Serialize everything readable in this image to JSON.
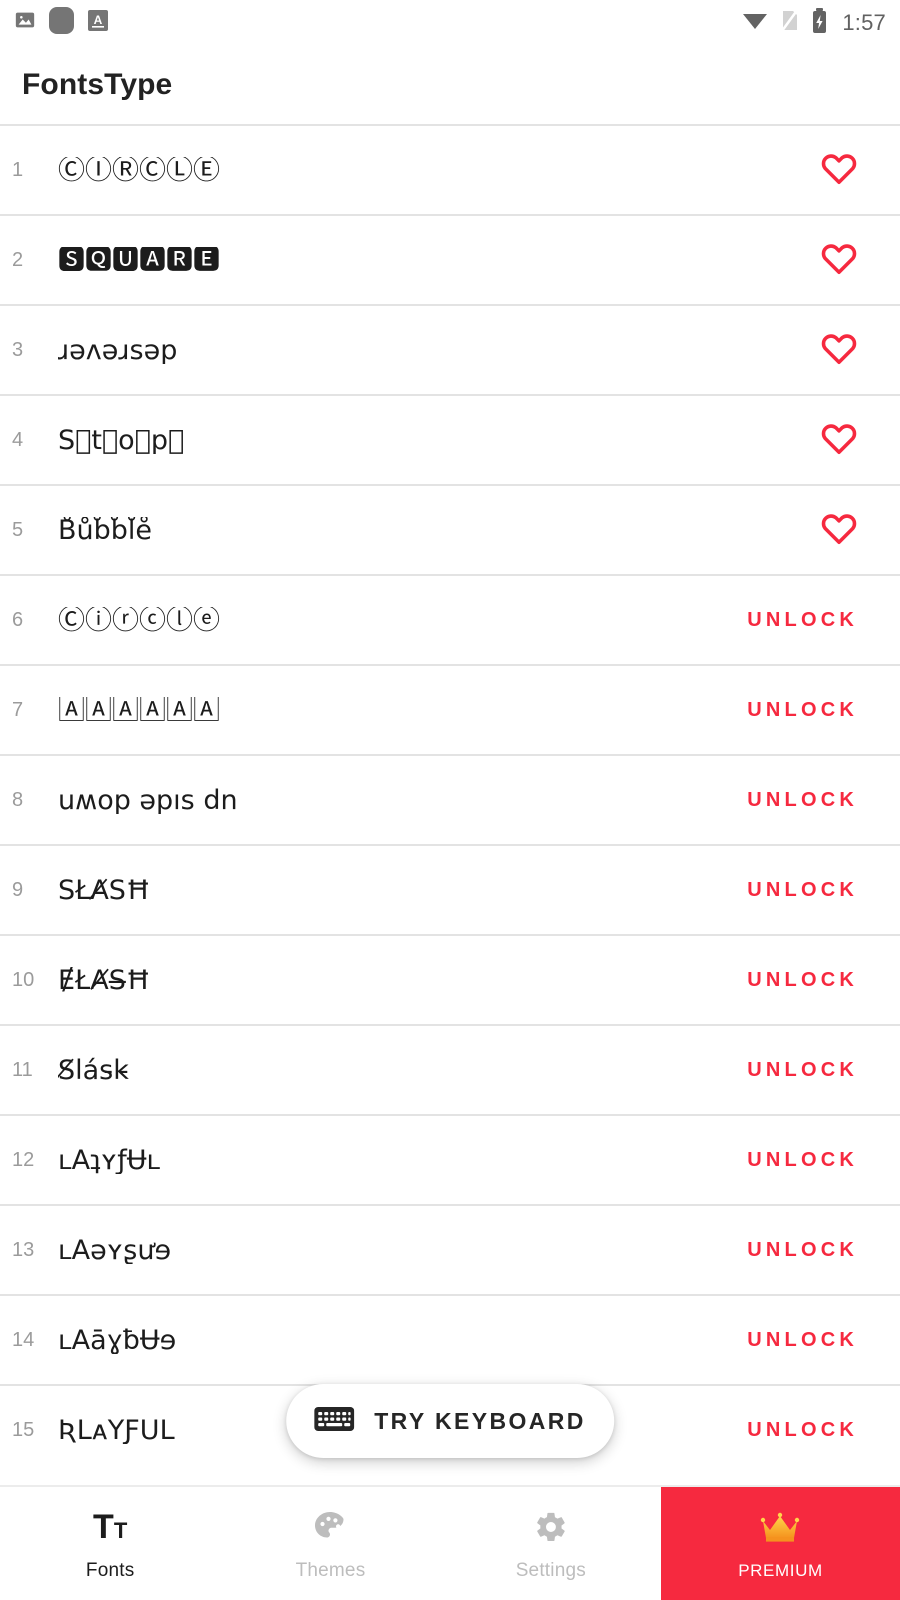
{
  "statusbar": {
    "time": "1:57",
    "left_icons": [
      "image-notification-icon",
      "rounded-square-notification-icon",
      "translate-notification-icon"
    ],
    "right_icons": [
      "wifi-icon",
      "no-sim-icon",
      "battery-charging-icon"
    ]
  },
  "header": {
    "title": "FontsType"
  },
  "list": {
    "rows": [
      {
        "index": "1",
        "sample": "ⒸⒾⓇⒸⓁⒺ",
        "action": "favorite",
        "unlock_label": ""
      },
      {
        "index": "2",
        "sample": "🆂🆀🆄🅰🆁🅴",
        "action": "favorite",
        "unlock_label": ""
      },
      {
        "index": "3",
        "sample": "ɹǝʌǝɹsǝp",
        "action": "favorite",
        "unlock_label": ""
      },
      {
        "index": "4",
        "sample": "S⃠t⃠o⃠p⃠",
        "action": "favorite",
        "unlock_label": ""
      },
      {
        "index": "5",
        "sample": "B̊ůb̊b̊l̊e̊",
        "action": "favorite",
        "unlock_label": ""
      },
      {
        "index": "6",
        "sample": "Ⓒⓘⓡⓒⓛⓔ",
        "action": "unlock",
        "unlock_label": "UNLOCK"
      },
      {
        "index": "7",
        "sample": "🄰🄰🄰🄰🄰🄰",
        "action": "unlock",
        "unlock_label": "UNLOCK"
      },
      {
        "index": "8",
        "sample": "uʍop ǝpıs dn",
        "action": "unlock",
        "unlock_label": "UNLOCK"
      },
      {
        "index": "9",
        "sample": "SŁA̸SĦ",
        "action": "unlock",
        "unlock_label": "UNLOCK"
      },
      {
        "index": "10",
        "sample": "ɆŁȺS̶Ħ",
        "action": "unlock",
        "unlock_label": "UNLOCK"
      },
      {
        "index": "11",
        "sample": "S̸lás̵k̵",
        "action": "unlock",
        "unlock_label": "UNLOCK"
      },
      {
        "index": "12",
        "sample": "ʟĀʇʏƒɄʟ",
        "action": "unlock",
        "unlock_label": "UNLOCK"
      },
      {
        "index": "13",
        "sample": "ʟĀǝʏʂưɘ",
        "action": "unlock",
        "unlock_label": "UNLOCK"
      },
      {
        "index": "14",
        "sample": "ʟĀāɣƀɄɘ",
        "action": "unlock",
        "unlock_label": "UNLOCK"
      },
      {
        "index": "15",
        "sample": "ƦLᴀYƑUL",
        "action": "unlock",
        "unlock_label": "UNLOCK"
      }
    ]
  },
  "fab": {
    "label": "TRY KEYBOARD",
    "icon": "keyboard-icon"
  },
  "bottomnav": {
    "items": [
      {
        "label": "Fonts",
        "icon": "text-format-icon",
        "active": true
      },
      {
        "label": "Themes",
        "icon": "palette-icon",
        "active": false
      },
      {
        "label": "Settings",
        "icon": "gear-icon",
        "active": false
      },
      {
        "label": "PREMIUM",
        "icon": "crown-icon",
        "active": false
      }
    ]
  },
  "colors": {
    "accent_red": "#f6293f",
    "divider": "#e3e3e3",
    "muted_text": "#9b9b9b",
    "crown_gold": "#fdbe1b"
  }
}
